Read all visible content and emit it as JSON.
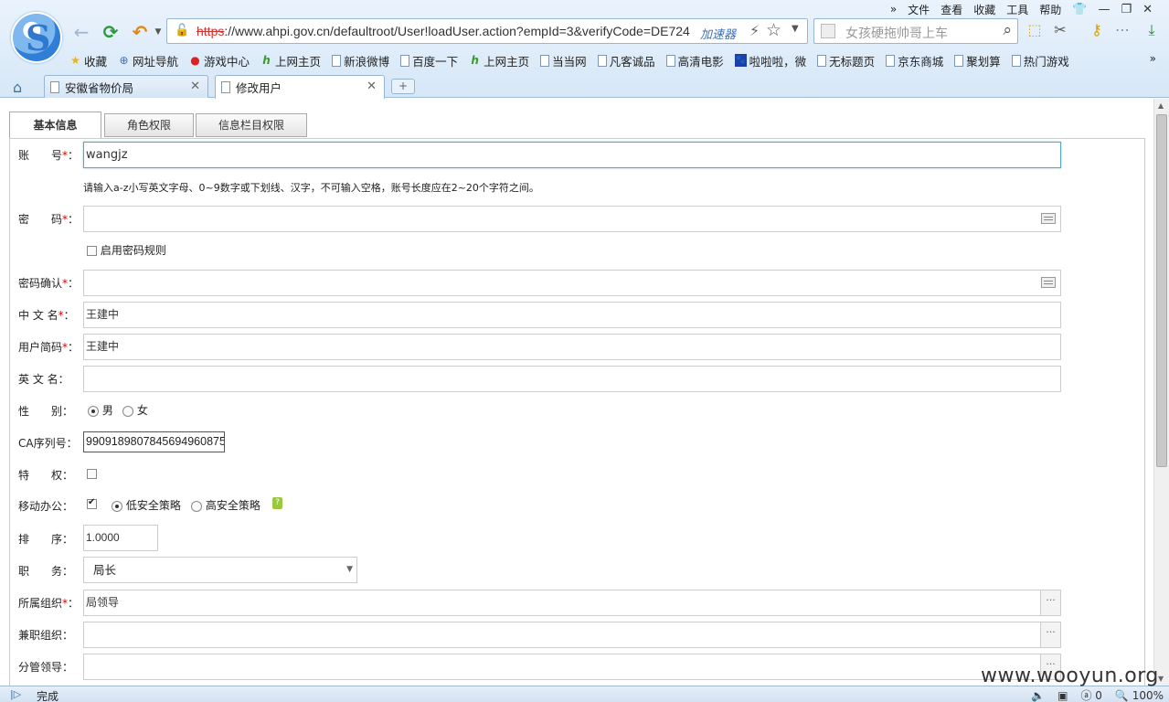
{
  "browser": {
    "menu": {
      "chevron": "»",
      "items": [
        "文件",
        "查看",
        "收藏",
        "工具",
        "帮助"
      ],
      "window_controls": [
        "👕",
        "—",
        "❐",
        "✕"
      ]
    },
    "nav": {
      "back_icon": "←",
      "refresh_icon": "⟳",
      "undo_icon": "↶"
    },
    "url": {
      "scheme": "https",
      "rest": "://www.ahpi.gov.cn/defaultroot/User!loadUser.action?empId=3&verifyCode=DE724"
    },
    "speedup_label": "加速器",
    "search": {
      "placeholder": "女孩硬拖帅哥上车"
    },
    "bookmarks": [
      {
        "label": "收藏",
        "icon": "★"
      },
      {
        "label": "网址导航",
        "icon": "⊕"
      },
      {
        "label": "游戏中心",
        "icon": "●"
      },
      {
        "label": "上网主页",
        "icon": "hao"
      },
      {
        "label": "新浪微博",
        "icon": "doc"
      },
      {
        "label": "百度一下",
        "icon": "doc"
      },
      {
        "label": "上网主页",
        "icon": "hao"
      },
      {
        "label": "当当网",
        "icon": "doc"
      },
      {
        "label": "凡客诚品",
        "icon": "doc"
      },
      {
        "label": "高清电影",
        "icon": "doc"
      },
      {
        "label": "啦啦啦，微",
        "icon": "paw"
      },
      {
        "label": "无标题页",
        "icon": "doc"
      },
      {
        "label": "京东商城",
        "icon": "doc"
      },
      {
        "label": "聚划算",
        "icon": "doc"
      },
      {
        "label": "热门游戏",
        "icon": "doc"
      }
    ],
    "bookmarks_more": "»",
    "tabs": [
      {
        "label": "安徽省物价局",
        "active": false
      },
      {
        "label": "修改用户",
        "active": true
      }
    ],
    "new_tab": "+"
  },
  "form": {
    "tabs": [
      "基本信息",
      "角色权限",
      "信息栏目权限"
    ],
    "fields": {
      "account": {
        "label": "账　　号",
        "required": true,
        "value": "wangjz"
      },
      "account_hint": "请输入a-z小写英文字母、0~9数字或下划线、汉字，不可输入空格，账号长度应在2~20个字符之间。",
      "password": {
        "label": "密　　码",
        "required": true,
        "value": ""
      },
      "password_rule": "启用密码规则",
      "password_confirm": {
        "label": "密码确认",
        "required": true,
        "value": ""
      },
      "chinese_name": {
        "label": "中 文 名",
        "required": true,
        "value": "王建中"
      },
      "user_short": {
        "label": "用户简码",
        "required": true,
        "value": "王建中"
      },
      "english_name": {
        "label": "英 文 名",
        "required": false,
        "value": ""
      },
      "gender": {
        "label": "性　　别",
        "options": [
          "男",
          "女"
        ],
        "selected": "男"
      },
      "ca_serial": {
        "label": "CA序列号",
        "value": "99091898078456949608​75"
      },
      "privilege": {
        "label": "特　　权",
        "checked": false
      },
      "mobile": {
        "label": "移动办公",
        "checked": true,
        "options": [
          "低安全策略",
          "高安全策略"
        ],
        "selected": "低安全策略"
      },
      "sort": {
        "label": "排　　序",
        "value": "1.0000"
      },
      "duty": {
        "label": "职　　务",
        "value": "局长"
      },
      "org": {
        "label": "所属组织",
        "required": true,
        "value": "局领导"
      },
      "part_org": {
        "label": "兼职组织",
        "required": false,
        "value": ""
      },
      "leader": {
        "label": "分管领导",
        "required": false,
        "value": ""
      }
    },
    "colon": "："
  },
  "status": {
    "text": "完成",
    "zoom": "100%",
    "count": "0"
  },
  "watermark": "www.wooyun.org"
}
